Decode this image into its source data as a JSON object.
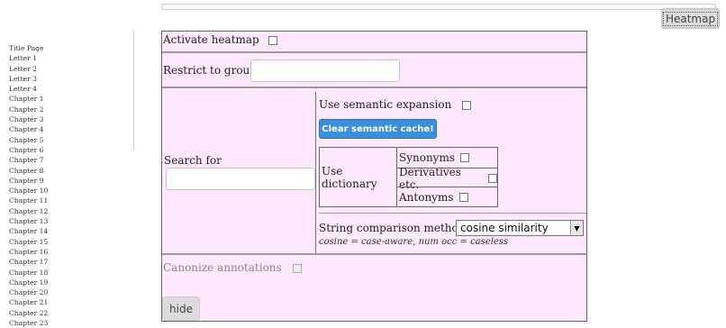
{
  "header": {
    "heatmap_button": "Heatmap"
  },
  "toc": {
    "items": [
      "Title Page",
      "Letter 1",
      "Letter 2",
      "Letter 3",
      "Letter 4",
      "Chapter 1",
      "Chapter 2",
      "Chapter 3",
      "Chapter 4",
      "Chapter 5",
      "Chapter 6",
      "Chapter 7",
      "Chapter 8",
      "Chapter 9",
      "Chapter 10",
      "Chapter 11",
      "Chapter 12",
      "Chapter 13",
      "Chapter 14",
      "Chapter 15",
      "Chapter 16",
      "Chapter 17",
      "Chapter 18",
      "Chapter 19",
      "Chapter 20",
      "Chapter 21",
      "Chapter 22",
      "Chapter 23"
    ]
  },
  "panel": {
    "activate_label": "Activate heatmap",
    "restrict_label": "Restrict to group",
    "restrict_value": "",
    "search_label": "Search for",
    "search_value": "",
    "semantic_label": "Use semantic expansion",
    "clear_cache_label": "Clear semantic cache!",
    "dictionary_label": "Use dictionary",
    "dictionary_options": [
      "Synonyms",
      "Derivatives etc.",
      "Antonyms"
    ],
    "comparison_label": "String comparison method",
    "comparison_value": "cosine similarity",
    "comparison_hint": "cosine = case-aware, num occ = caseless",
    "canonize_label": "Canonize annotations",
    "hide_label": "hide"
  },
  "colors": {
    "panel_bg": "#fde8fd",
    "button_blue": "#3d8fd9",
    "button_gray": "#dcdcdc"
  }
}
